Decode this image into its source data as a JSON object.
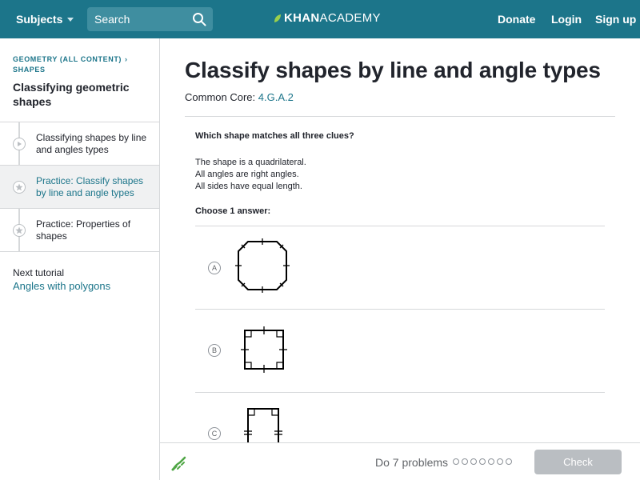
{
  "topbar": {
    "subjects_label": "Subjects",
    "search_placeholder": "Search",
    "logo_khan": "KHAN",
    "logo_academy": "ACADEMY",
    "donate": "Donate",
    "login": "Login",
    "signup": "Sign up",
    "accent_color": "#1c758a"
  },
  "sidebar": {
    "breadcrumb_line1": "GEOMETRY (ALL CONTENT)",
    "breadcrumb_line2": "SHAPES",
    "tutorial_title": "Classifying geometric shapes",
    "items": [
      {
        "label": "Classifying shapes by line and angles types",
        "icon": "play-icon",
        "active": false
      },
      {
        "label": "Practice: Classify shapes by line and angle types",
        "icon": "star-icon",
        "active": true
      },
      {
        "label": "Practice: Properties of shapes",
        "icon": "star-icon",
        "active": false
      }
    ],
    "next_label": "Next tutorial",
    "next_link": "Angles with polygons"
  },
  "main": {
    "title": "Classify shapes by line and angle types",
    "standard_prefix": "Common Core:",
    "standard_code": "4.G.A.2",
    "question": "Which shape matches all three clues?",
    "clues": [
      "The shape is a quadrilateral.",
      "All angles are right angles.",
      "All sides have equal length."
    ],
    "choose_label": "Choose 1 answer:",
    "options": [
      {
        "letter": "A",
        "shape": "octagon"
      },
      {
        "letter": "B",
        "shape": "square"
      },
      {
        "letter": "C",
        "shape": "rectangle"
      }
    ]
  },
  "bottom": {
    "problems_label": "Do 7 problems",
    "progress_total": 7,
    "progress_done": 0,
    "check_label": "Check"
  }
}
